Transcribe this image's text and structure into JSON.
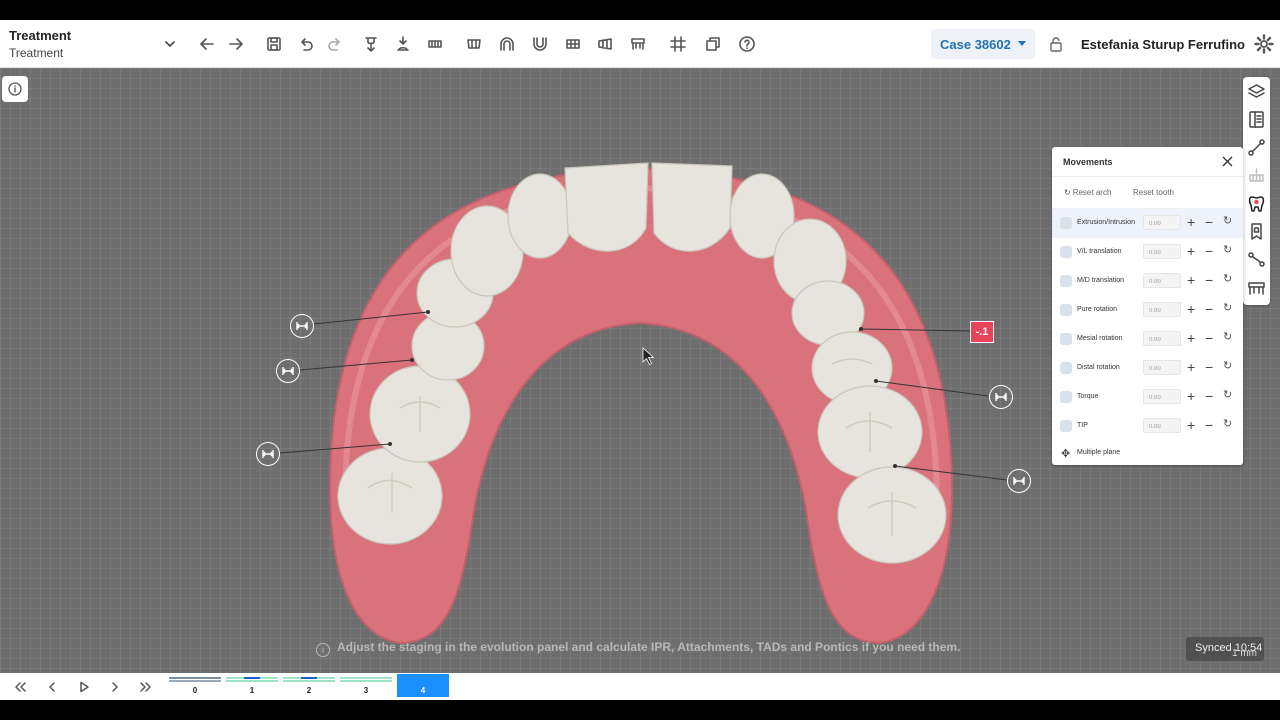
{
  "header": {
    "title": "Treatment",
    "subtitle": "Treatment",
    "case_label": "Case 38602",
    "user_name": "Estefania Sturup Ferrufino"
  },
  "toolbar": {
    "icons": [
      "back-arrow-icon",
      "forward-arrow-icon",
      "save-icon",
      "undo-icon",
      "redo-icon",
      "upper-jaw-icon",
      "lower-jaw-icon",
      "occlusal-view-icon",
      "frontal-view-icon",
      "arch-upper-icon",
      "arch-lower-icon",
      "left-view-icon",
      "right-view-icon",
      "bite-view-icon",
      "grid-icon",
      "overlay-icon",
      "help-icon"
    ]
  },
  "movements_panel": {
    "title": "Movements",
    "reset_arch": "Reset arch",
    "reset_tooth": "Reset tooth",
    "rows": [
      {
        "label": "Extrusion/Intrusion",
        "value": "0.00"
      },
      {
        "label": "V/L translation",
        "value": "0.00"
      },
      {
        "label": "M/D translation",
        "value": "0.00"
      },
      {
        "label": "Pure rotation",
        "value": "0.00"
      },
      {
        "label": "Mesial rotation",
        "value": "0.00"
      },
      {
        "label": "Distal rotation",
        "value": "0.00"
      },
      {
        "label": "Torque",
        "value": "0.00"
      },
      {
        "label": "TIP",
        "value": "0.00"
      }
    ],
    "multiple_plane": "Multiple plane"
  },
  "ipr": {
    "red_marker": "-.1"
  },
  "hint": "Adjust the staging in the evolution panel and calculate IPR, Attachments, TADs and Pontics if you need them.",
  "status": {
    "synced": "Synced 10:54",
    "scale": "1 mm"
  },
  "stages": [
    {
      "label": "0",
      "active": false
    },
    {
      "label": "1",
      "active": false
    },
    {
      "label": "2",
      "active": false
    },
    {
      "label": "3",
      "active": false
    },
    {
      "label": "4",
      "active": true
    }
  ],
  "colors": {
    "accent": "#1f73b7",
    "active_stage": "#1a8fff",
    "gum": "#e07a82",
    "ipr_red": "#e8455a"
  }
}
